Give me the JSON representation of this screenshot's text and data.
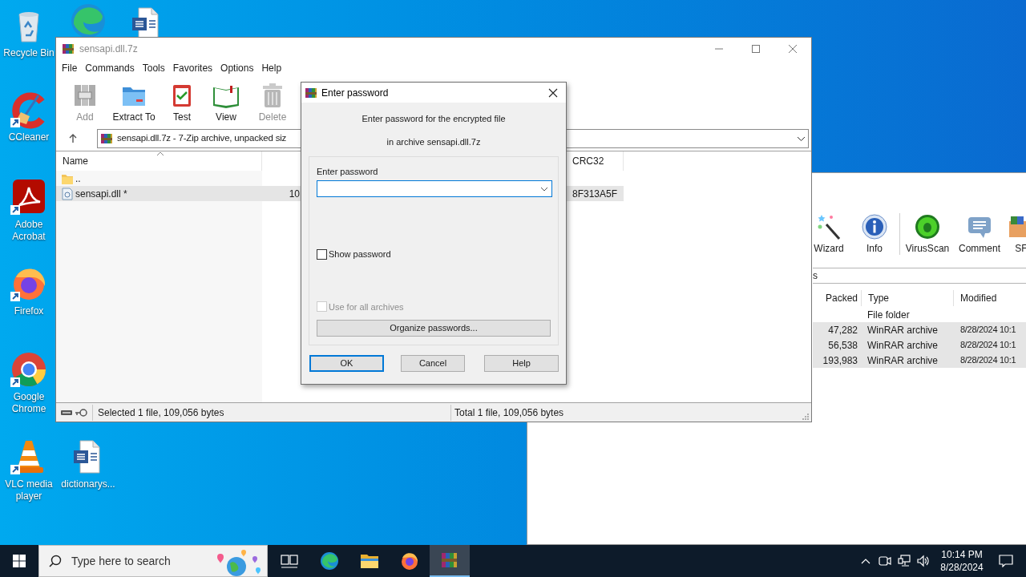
{
  "desktop": {
    "icons": [
      {
        "kind": "recycle",
        "label": "Recycle Bin",
        "shortcut": false
      },
      {
        "kind": "edge",
        "shortcut": false
      },
      {
        "kind": "word",
        "shortcut": false
      },
      {
        "kind": "ccleaner",
        "label": "CCleaner",
        "shortcut": true
      },
      {
        "kind": "acrobat",
        "label": "Adobe Acrobat",
        "shortcut": true
      },
      {
        "kind": "firefox",
        "label": "Firefox",
        "shortcut": true
      },
      {
        "kind": "chrome",
        "label": "Google Chrome",
        "shortcut": true
      },
      {
        "kind": "vlc",
        "label": "VLC media player",
        "shortcut": true
      },
      {
        "kind": "word",
        "label": "dictionarys...",
        "shortcut": false
      }
    ]
  },
  "background_window": {
    "toolbar": [
      {
        "kind": "wizard",
        "label": "Wizard"
      },
      {
        "kind": "info",
        "label": "Info"
      },
      {
        "kind": "separator"
      },
      {
        "kind": "virusscan",
        "label": "VirusScan"
      },
      {
        "kind": "comment",
        "label": "Comment"
      },
      {
        "kind": "sfx",
        "label": "SF"
      }
    ],
    "address": "s",
    "columns": [
      "Packed",
      "Type",
      "Modified"
    ],
    "rows": [
      {
        "type": "File folder",
        "selected": false
      },
      {
        "packed": "47,282",
        "type": "WinRAR archive",
        "modified": "8/28/2024 10:1",
        "selected": true
      },
      {
        "packed": "56,538",
        "type": "WinRAR archive",
        "modified": "8/28/2024 10:1",
        "selected": true
      },
      {
        "packed": "193,983",
        "type": "WinRAR archive",
        "modified": "8/28/2024 10:1",
        "selected": true
      }
    ]
  },
  "main_window": {
    "title": "sensapi.dll.7z",
    "active": false,
    "menu": [
      "File",
      "Commands",
      "Tools",
      "Favorites",
      "Options",
      "Help"
    ],
    "toolbar": [
      {
        "kind": "add",
        "label": "Add",
        "disabled": true
      },
      {
        "kind": "extract",
        "label": "Extract To",
        "disabled": false
      },
      {
        "kind": "test",
        "label": "Test",
        "disabled": false
      },
      {
        "kind": "view",
        "label": "View",
        "disabled": false
      },
      {
        "kind": "delete",
        "label": "Delete",
        "disabled": true
      }
    ],
    "address": "sensapi.dll.7z - 7-Zip archive, unpacked siz",
    "columns": {
      "name": "Name",
      "crc": "CRC32"
    },
    "rows": [
      {
        "kind": "folder",
        "name": "..",
        "selected": false
      },
      {
        "kind": "file",
        "name": "sensapi.dll *",
        "size": "10",
        "crc": "8F313A5F",
        "selected": true
      }
    ],
    "status_left": "Selected 1 file, 109,056 bytes",
    "status_right": "Total 1 file, 109,056 bytes"
  },
  "dialog": {
    "title": "Enter password",
    "message": [
      "Enter password for the encrypted file",
      "in archive sensapi.dll.7z"
    ],
    "password_label": "Enter password",
    "show_password": {
      "label": "Show password",
      "checked": false,
      "disabled": false
    },
    "use_for_all": {
      "label": "Use for all archives",
      "checked": false,
      "disabled": true
    },
    "organize_button": "Organize passwords...",
    "buttons": [
      {
        "label": "OK",
        "default": true
      },
      {
        "label": "Cancel",
        "default": false
      },
      {
        "label": "Help",
        "default": false
      }
    ]
  },
  "taskbar": {
    "search_placeholder": "Type here to search",
    "apps": [
      {
        "kind": "taskview",
        "active": false
      },
      {
        "kind": "edge",
        "active": false
      },
      {
        "kind": "explorer",
        "active": false
      },
      {
        "kind": "firefox",
        "active": false
      },
      {
        "kind": "winrar",
        "active": true
      }
    ],
    "time": "10:14 PM",
    "date": "8/28/2024"
  }
}
